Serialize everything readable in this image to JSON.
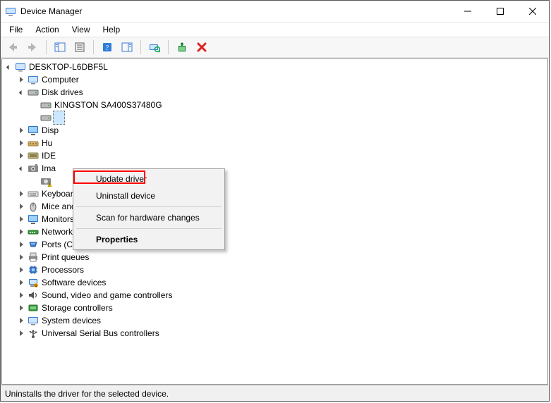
{
  "window": {
    "title": "Device Manager"
  },
  "menu": {
    "file": "File",
    "action": "Action",
    "view": "View",
    "help": "Help"
  },
  "tree": {
    "root": "DESKTOP-L6DBF5L",
    "computer": "Computer",
    "disk_drives": "Disk drives",
    "kingston": "KINGSTON SA400S37480G",
    "display": "Disp",
    "hid": "Hu",
    "ide": "IDE",
    "imaging": "Ima",
    "keyboards": "Keyboards",
    "mice": "Mice and other pointing devices",
    "monitors": "Monitors",
    "network": "Network adapters",
    "ports": "Ports (COM & LPT)",
    "print_queues": "Print queues",
    "processors": "Processors",
    "software_devices": "Software devices",
    "sound": "Sound, video and game controllers",
    "storage": "Storage controllers",
    "system": "System devices",
    "usb": "Universal Serial Bus controllers"
  },
  "context_menu": {
    "update_driver": "Update driver",
    "uninstall": "Uninstall device",
    "scan": "Scan for hardware changes",
    "properties": "Properties"
  },
  "status": "Uninstalls the driver for the selected device."
}
